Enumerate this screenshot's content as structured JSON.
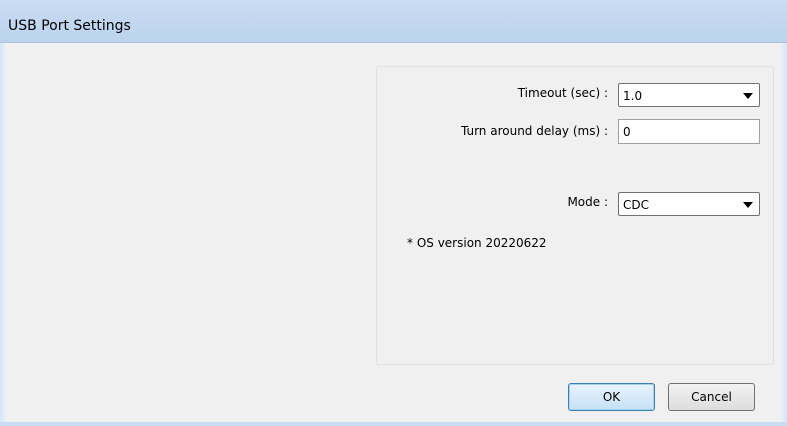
{
  "window": {
    "title": "USB Port Settings"
  },
  "settings": {
    "timeout_label": "Timeout (sec) :",
    "timeout_value": "1.0",
    "delay_label": "Turn around delay (ms) :",
    "delay_value": "0",
    "mode_label": "Mode :",
    "mode_value": "CDC",
    "os_note": "* OS version 20220622"
  },
  "buttons": {
    "ok": "OK",
    "cancel": "Cancel"
  },
  "colors": {
    "title_bar": "#bcd3ee",
    "dialog_bg": "#f0f0f0",
    "default_button_border": "#3c7fb1"
  }
}
